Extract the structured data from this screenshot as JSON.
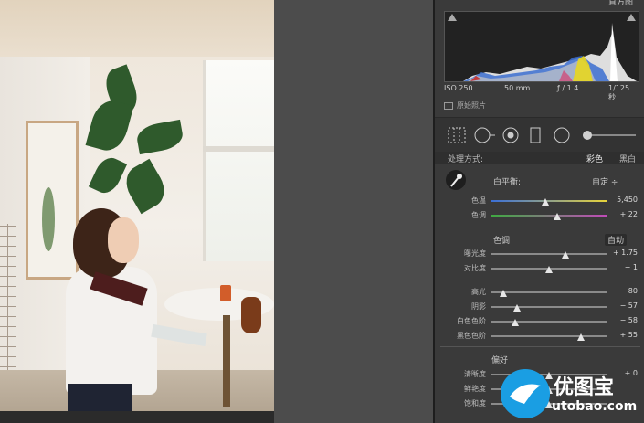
{
  "hist_header": "直方图",
  "histogram": {
    "iso": "ISO 250",
    "focal": "50 mm",
    "aperture": "ƒ / 1.4",
    "shutter": "1/125 秒"
  },
  "original_photo_label": "原始照片",
  "section_basic": {
    "left": "处理方式:",
    "color_tab": "彩色",
    "bw_tab": "黑白"
  },
  "white_balance": {
    "label": "白平衡:",
    "value": "自定 ÷"
  },
  "wb_rows": [
    {
      "label": "色温",
      "value": "5,450",
      "level": 0.47
    },
    {
      "label": "色调",
      "value": "+ 22",
      "level": 0.57
    }
  ],
  "tone": {
    "label": "色调",
    "auto": "自动"
  },
  "tone_rows": [
    {
      "label": "曝光度",
      "value": "+ 1.75",
      "level": 0.64
    },
    {
      "label": "对比度",
      "value": "− 1",
      "level": 0.5
    }
  ],
  "tone_rows2": [
    {
      "label": "高光",
      "value": "− 80",
      "level": 0.1
    },
    {
      "label": "阴影",
      "value": "− 57",
      "level": 0.22
    },
    {
      "label": "白色色阶",
      "value": "− 58",
      "level": 0.21
    },
    {
      "label": "黑色色阶",
      "value": "+ 55",
      "level": 0.78
    }
  ],
  "presence": {
    "label": "偏好"
  },
  "presence_rows": [
    {
      "label": "清晰度",
      "value": "+ 0",
      "level": 0.5
    },
    {
      "label": "鲜艳度",
      "value": "",
      "level": 0.5
    },
    {
      "label": "饱和度",
      "value": "",
      "level": 0.5
    }
  ],
  "watermark": {
    "name": "优图宝",
    "url": "utobao.com"
  },
  "colors": {
    "accent_blue": "#1a9ee3",
    "panel_bg": "#3a3a3a",
    "middle_bg": "#4c4c4c"
  }
}
